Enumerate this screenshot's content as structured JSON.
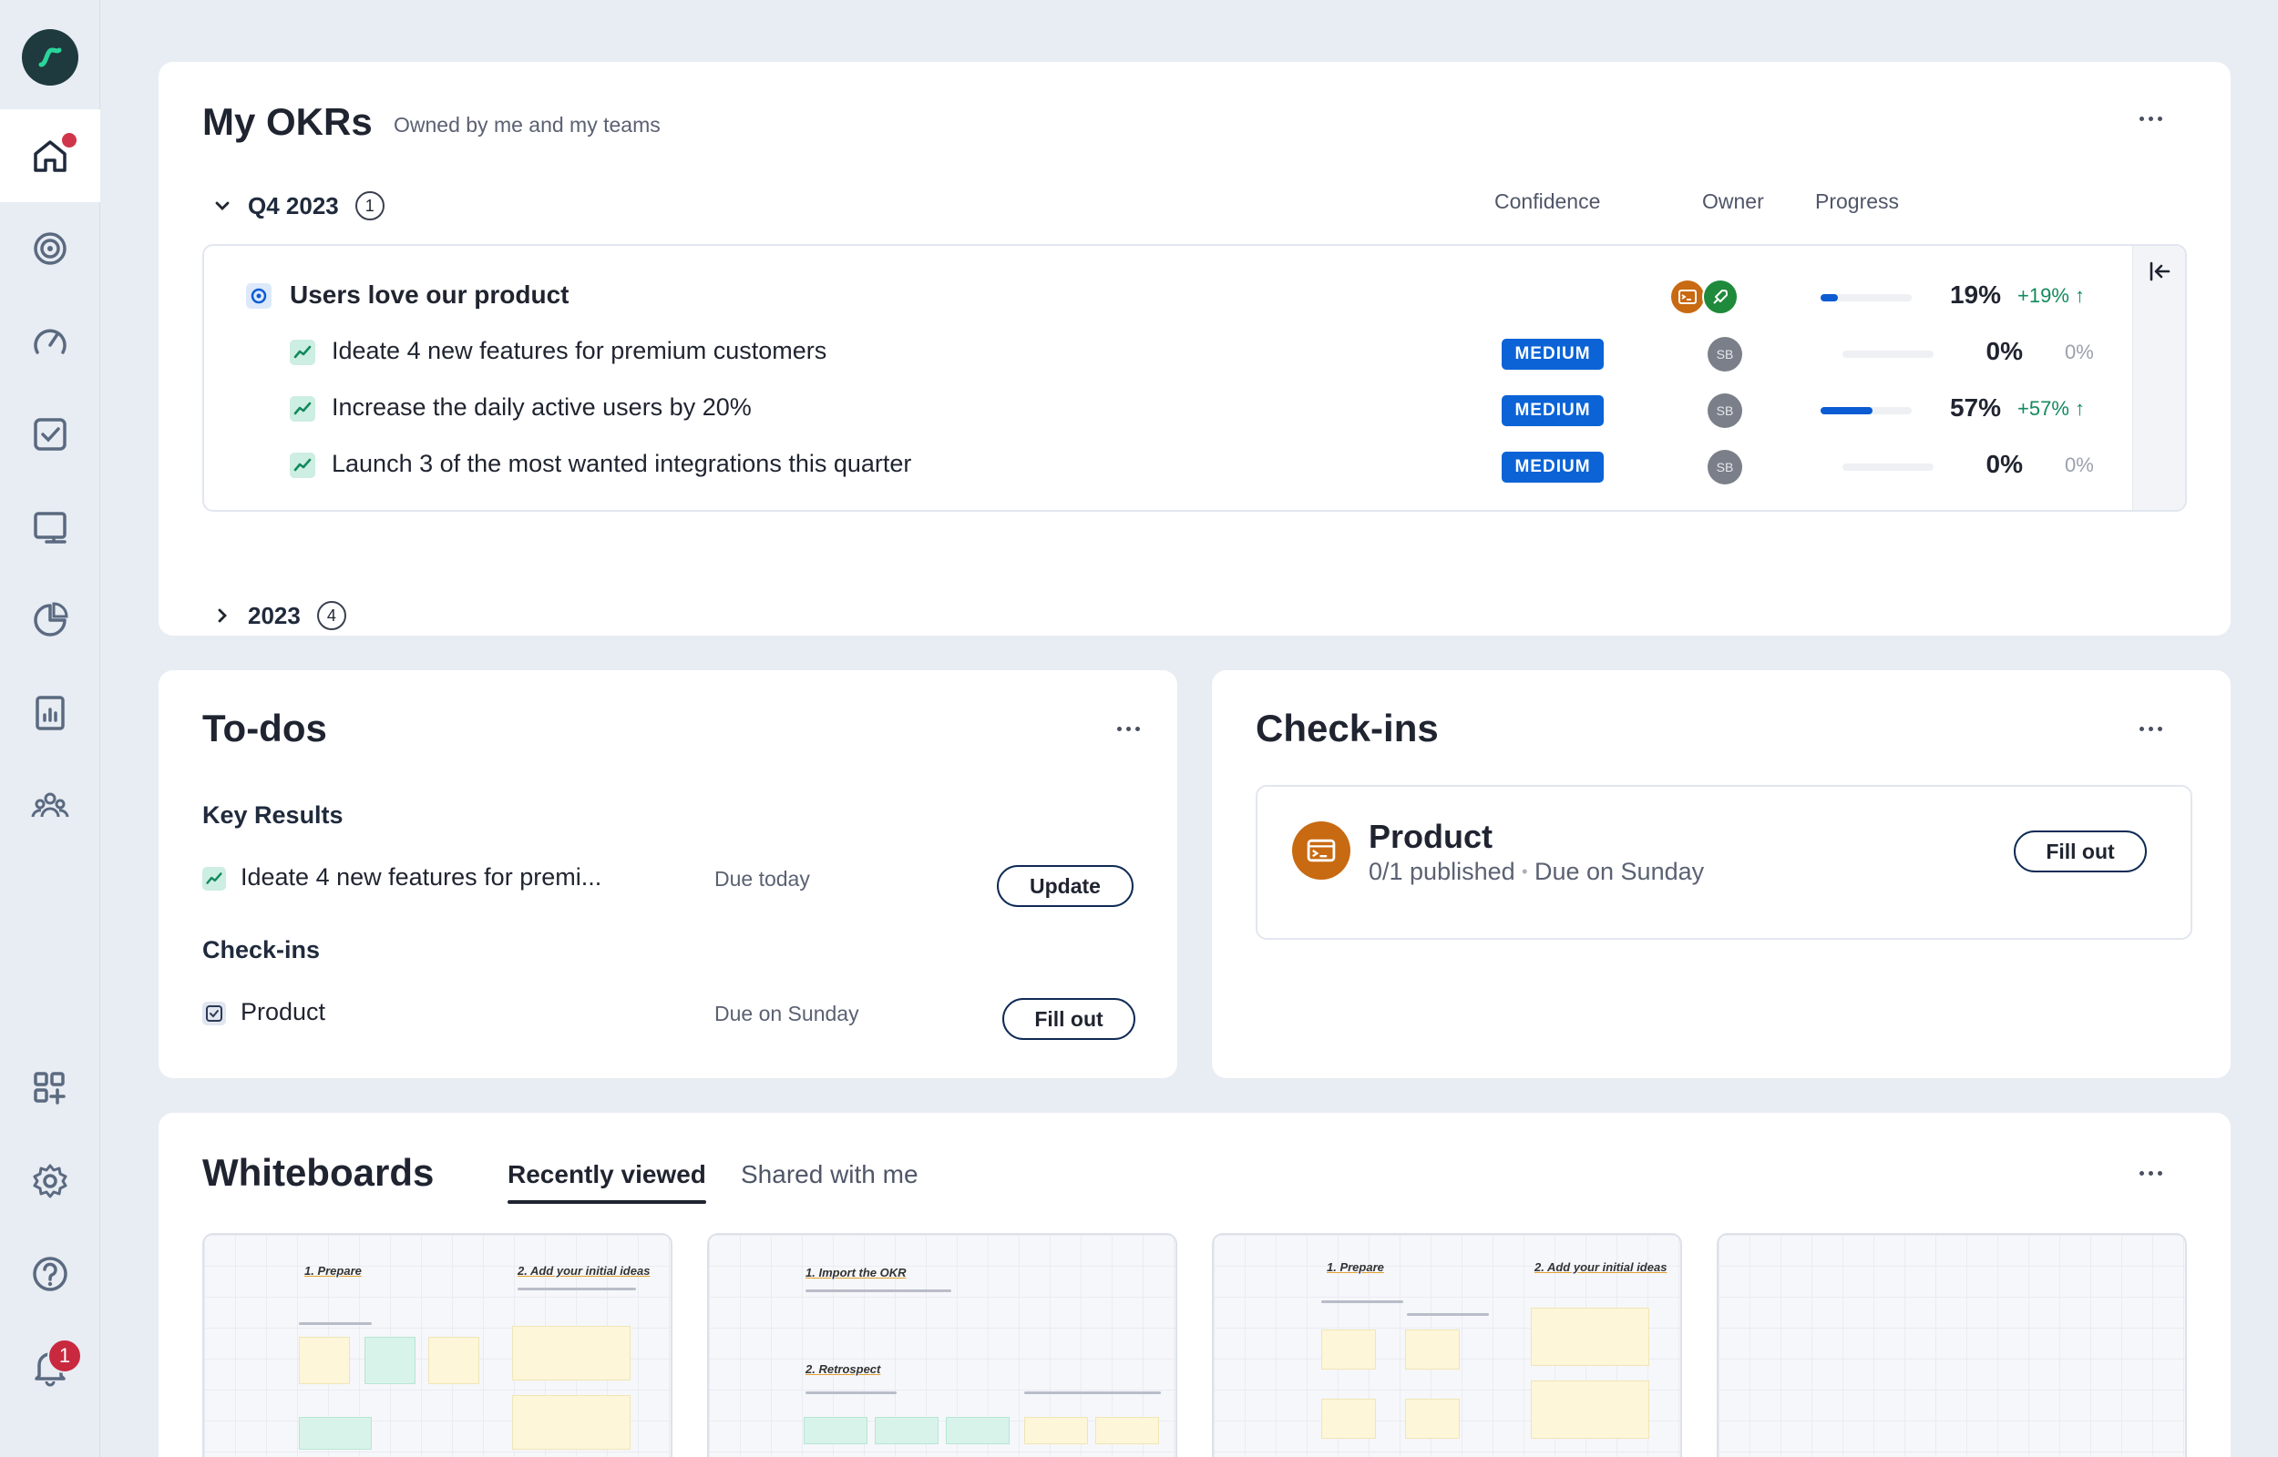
{
  "colors": {
    "accent": "#0b63d6",
    "brand_dark": "#1e3a3e",
    "positive": "#138a5e",
    "badge_red": "#c8293f",
    "product_orange": "#c86a12"
  },
  "sidebar": {
    "icons": [
      "logo-icon",
      "home-icon",
      "target-icon",
      "gauge-icon",
      "checkbox-icon",
      "whiteboard-icon",
      "pie-chart-icon",
      "report-icon",
      "team-icon",
      "apps-icon",
      "gear-icon",
      "help-icon",
      "bell-icon"
    ],
    "notification_count": "1"
  },
  "okrs": {
    "title": "My OKRs",
    "subtitle": "Owned by me and my teams",
    "columns": {
      "confidence": "Confidence",
      "owner": "Owner",
      "progress": "Progress"
    },
    "period": {
      "label": "Q4 2023",
      "count": "1"
    },
    "objective": {
      "title": "Users love our product",
      "progress": "19%",
      "delta": "+19%",
      "progress_value": 0.19
    },
    "key_results": [
      {
        "title": "Ideate 4 new features for premium customers",
        "confidence": "MEDIUM",
        "owner": "SB",
        "progress": "0%",
        "delta": "0%",
        "progress_value": 0.0
      },
      {
        "title": "Increase the daily active users by 20%",
        "confidence": "MEDIUM",
        "owner": "SB",
        "progress": "57%",
        "delta": "+57%",
        "progress_value": 0.57
      },
      {
        "title": "Launch 3 of the most wanted integrations this quarter",
        "confidence": "MEDIUM",
        "owner": "SB",
        "progress": "0%",
        "delta": "0%",
        "progress_value": 0.0
      }
    ],
    "collapsed_period": {
      "label": "2023",
      "count": "4"
    }
  },
  "todos": {
    "title": "To-dos",
    "key_results_heading": "Key Results",
    "key_result_item": {
      "title": "Ideate 4 new features for premi...",
      "due": "Due today",
      "action": "Update"
    },
    "checkins_heading": "Check-ins",
    "checkin_item": {
      "title": "Product",
      "due": "Due on Sunday",
      "action": "Fill out"
    }
  },
  "checkins": {
    "title": "Check-ins",
    "item": {
      "name": "Product",
      "published": "0/1 published",
      "separator": "•",
      "due": "Due on Sunday",
      "action": "Fill out"
    }
  },
  "whiteboards": {
    "title": "Whiteboards",
    "tabs": [
      "Recently viewed",
      "Shared with me"
    ],
    "active_tab": "Recently viewed",
    "thumbnails": [
      {
        "headings": [
          "1. Prepare",
          "2. Add your initial ideas"
        ]
      },
      {
        "headings": [
          "1. Import the OKR",
          "2. Retrospect"
        ]
      },
      {
        "headings": [
          "1. Prepare",
          "2. Add your initial ideas"
        ]
      },
      {
        "headings": []
      }
    ]
  }
}
